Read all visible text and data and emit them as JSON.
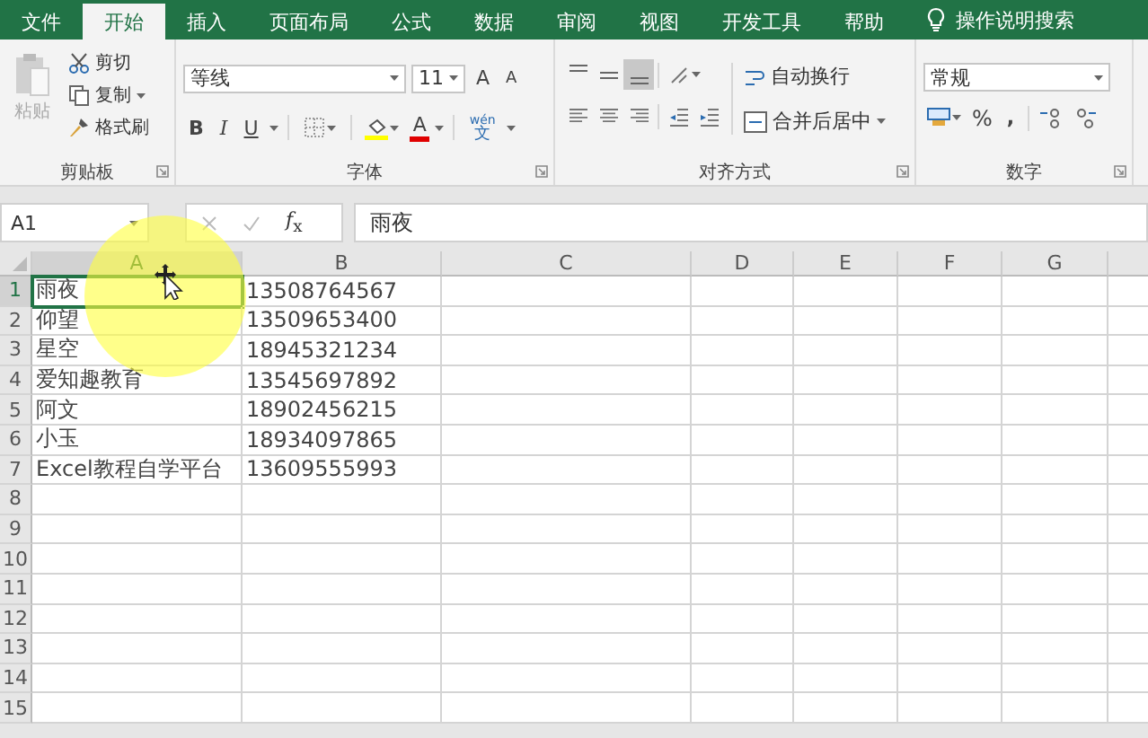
{
  "tabs": [
    {
      "label": "文件",
      "selected": false
    },
    {
      "label": "开始",
      "selected": true
    },
    {
      "label": "插入",
      "selected": false
    },
    {
      "label": "页面布局",
      "selected": false
    },
    {
      "label": "公式",
      "selected": false
    },
    {
      "label": "数据",
      "selected": false
    },
    {
      "label": "审阅",
      "selected": false
    },
    {
      "label": "视图",
      "selected": false
    },
    {
      "label": "开发工具",
      "selected": false
    },
    {
      "label": "帮助",
      "selected": false
    }
  ],
  "tell_me": "操作说明搜索",
  "clipboard": {
    "paste": "粘贴",
    "paste_disabled": true,
    "cut": "剪切",
    "copy": "复制",
    "format_painter": "格式刷",
    "label": "剪贴板"
  },
  "font": {
    "name": "等线",
    "size": "11",
    "grow": "A",
    "shrink": "A",
    "bold": "B",
    "italic": "I",
    "underline": "U",
    "font_color": "A",
    "phonetic": "wén",
    "phonetic_char": "文",
    "label": "字体"
  },
  "alignment": {
    "vertical_align": [
      {
        "selected": false
      },
      {
        "selected": false
      },
      {
        "selected": true
      }
    ],
    "wrap_text": "自动换行",
    "merge_center": "合并后居中",
    "label": "对齐方式"
  },
  "number": {
    "format": "常规",
    "percent": "%",
    "comma": ",",
    "label": "数字"
  },
  "formula_bar": {
    "name_box": "A1",
    "fx": "*f*$_{x}$",
    "content": "雨夜"
  },
  "sheet": {
    "columns": [
      "A",
      "B",
      "C",
      "D",
      "E",
      "F",
      "G"
    ],
    "rows": [
      {
        "header": "1",
        "cells": [
          {
            "text": "雨夜",
            "selected": true
          },
          {
            "text": "13508764567",
            "selected": false
          }
        ]
      },
      {
        "header": "2",
        "cells": [
          {
            "text": "仰望",
            "selected": false
          },
          {
            "text": "13509653400",
            "selected": false
          }
        ]
      },
      {
        "header": "3",
        "cells": [
          {
            "text": "星空",
            "selected": false
          },
          {
            "text": "18945321234",
            "selected": false
          }
        ]
      },
      {
        "header": "4",
        "cells": [
          {
            "text": "爱知趣教育",
            "selected": false
          },
          {
            "text": "13545697892",
            "selected": false
          }
        ]
      },
      {
        "header": "5",
        "cells": [
          {
            "text": "阿文",
            "selected": false
          },
          {
            "text": "18902456215",
            "selected": false
          }
        ]
      },
      {
        "header": "6",
        "cells": [
          {
            "text": "小玉",
            "selected": false
          },
          {
            "text": "18934097865",
            "selected": false
          }
        ]
      },
      {
        "header": "7",
        "cells": [
          {
            "text": "Excel教程自学平台",
            "selected": false
          },
          {
            "text": "13609555993",
            "selected": false
          }
        ]
      },
      {
        "header": "8"
      },
      {
        "header": "9"
      },
      {
        "header": "10"
      },
      {
        "header": "11"
      },
      {
        "header": "12"
      },
      {
        "header": "13"
      },
      {
        "header": "14"
      },
      {
        "header": "15"
      }
    ]
  }
}
